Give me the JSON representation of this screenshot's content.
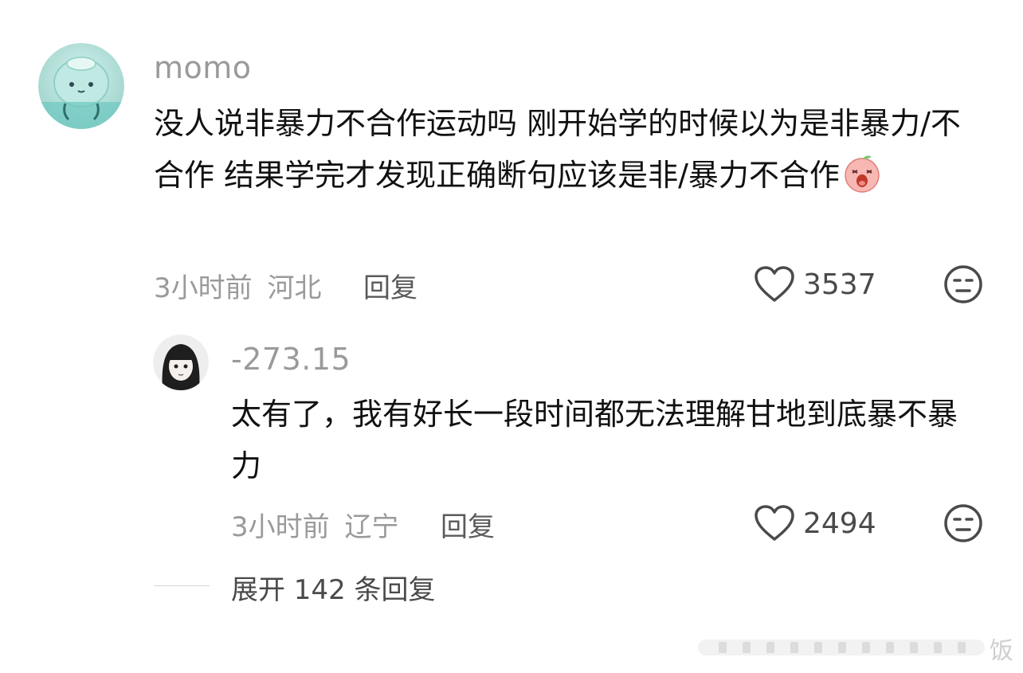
{
  "comments": [
    {
      "username": "momo",
      "text": "没人说非暴力不合作运动吗 刚开始学的时候以为是非暴力/不合作 结果学完才发现正确断句应该是非/暴力不合作",
      "emoji": "crying-peach-emoji",
      "time": "3小时前",
      "location": "河北",
      "reply_label": "回复",
      "likes": "3537"
    },
    {
      "username": "-273.15",
      "text": "太有了，我有好长一段时间都无法理解甘地到底暴不暴力",
      "time": "3小时前",
      "location": "辽宁",
      "reply_label": "回复",
      "likes": "2494"
    }
  ],
  "expand": {
    "label": "展开 142 条回复"
  },
  "watermark": {
    "text": "饭"
  },
  "icons": {
    "like": "heart-outline-icon",
    "dislike": "unamused-face-icon"
  },
  "colors": {
    "text": "#111111",
    "muted": "#9a9a9a",
    "secondary": "#4a4a4a"
  }
}
